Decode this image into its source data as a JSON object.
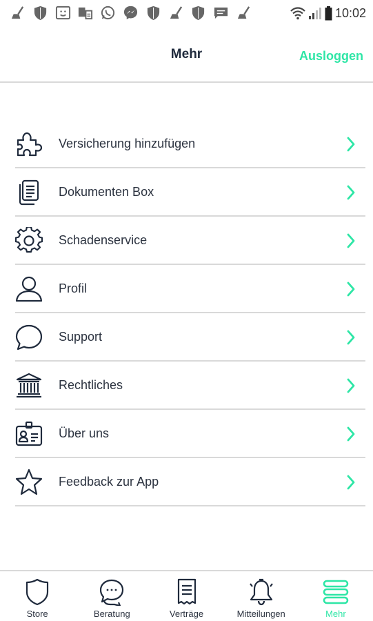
{
  "status_bar": {
    "time": "10:02",
    "notification_icons": [
      "broom-icon",
      "shield-icon",
      "smiley-box-icon",
      "sync-icon",
      "whatsapp-icon",
      "messenger-icon",
      "shield-icon",
      "broom-icon",
      "shield-icon",
      "message-icon",
      "broom-icon"
    ]
  },
  "header": {
    "title": "Mehr",
    "logout_label": "Ausloggen"
  },
  "menu": {
    "items": [
      {
        "label": "Versicherung hinzufügen",
        "icon": "puzzle-icon"
      },
      {
        "label": "Dokumenten Box",
        "icon": "documents-icon"
      },
      {
        "label": "Schadenservice",
        "icon": "gear-icon"
      },
      {
        "label": "Profil",
        "icon": "person-icon"
      },
      {
        "label": "Support",
        "icon": "chat-bubble-icon"
      },
      {
        "label": "Rechtliches",
        "icon": "courthouse-icon"
      },
      {
        "label": "Über uns",
        "icon": "id-card-icon"
      },
      {
        "label": "Feedback zur App",
        "icon": "star-icon"
      }
    ]
  },
  "tabbar": {
    "tabs": [
      {
        "label": "Store",
        "icon": "shield-icon",
        "active": false
      },
      {
        "label": "Beratung",
        "icon": "chat-bubbles-icon",
        "active": false
      },
      {
        "label": "Verträge",
        "icon": "document-icon",
        "active": false
      },
      {
        "label": "Mitteilungen",
        "icon": "bell-icon",
        "active": false
      },
      {
        "label": "Mehr",
        "icon": "menu-stack-icon",
        "active": true
      }
    ]
  },
  "colors": {
    "accent": "#2ee6a6",
    "text": "#27303d",
    "divider": "#d9d9d9",
    "icon": "#1f2a3c"
  }
}
